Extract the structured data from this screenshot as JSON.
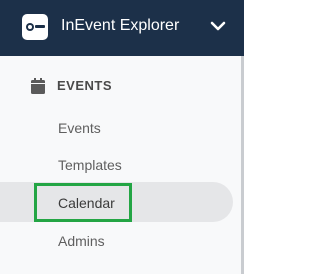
{
  "header": {
    "app_title": "InEvent Explorer",
    "logo_icon": "inevent-logo-icon",
    "toggle_icon": "chevron-down-icon"
  },
  "sidebar": {
    "section": {
      "icon": "calendar-icon",
      "label": "EVENTS"
    },
    "items": [
      {
        "label": "Events",
        "active": false
      },
      {
        "label": "Templates",
        "active": false
      },
      {
        "label": "Calendar",
        "active": true
      },
      {
        "label": "Admins",
        "active": false
      }
    ]
  },
  "colors": {
    "header_bg": "#1c3049",
    "sidebar_bg": "#f8f9fa",
    "active_bg": "#e5e6e8",
    "highlight": "#23a544"
  }
}
